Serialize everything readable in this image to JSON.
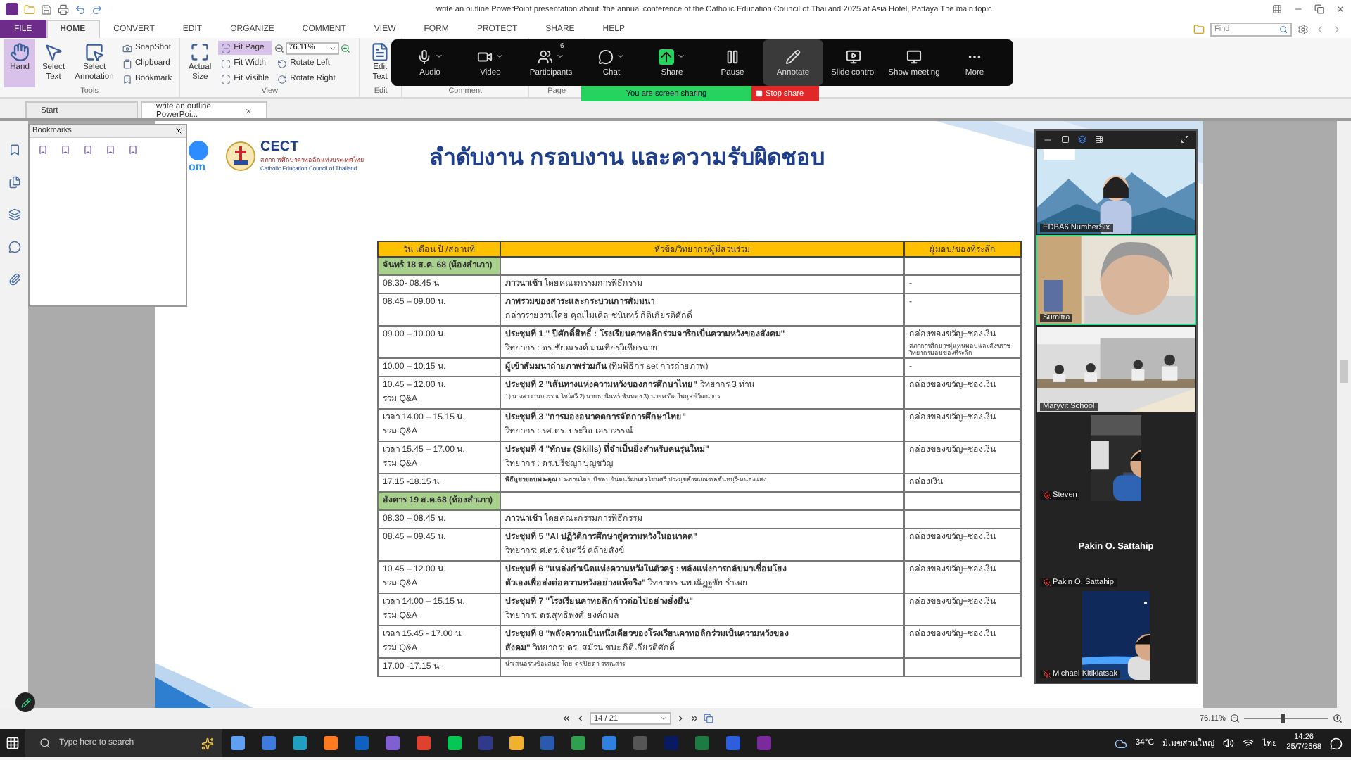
{
  "title_bar": {
    "title": "write an outline PowerPoint presentation about \"the annual conference of the Catholic Education Council of Thailand 2025 at Asia Hotel, Pattaya The main topic"
  },
  "menu_tabs": [
    {
      "label": "FILE",
      "kind": "file",
      "selected": false
    },
    {
      "label": "HOME",
      "kind": "tab",
      "selected": true
    },
    {
      "label": "CONVERT",
      "kind": "tab",
      "selected": false
    },
    {
      "label": "EDIT",
      "kind": "tab",
      "selected": false
    },
    {
      "label": "ORGANIZE",
      "kind": "tab",
      "selected": false
    },
    {
      "label": "COMMENT",
      "kind": "tab",
      "selected": false
    },
    {
      "label": "VIEW",
      "kind": "tab",
      "selected": false
    },
    {
      "label": "FORM",
      "kind": "tab",
      "selected": false
    },
    {
      "label": "PROTECT",
      "kind": "tab",
      "selected": false
    },
    {
      "label": "SHARE",
      "kind": "tab",
      "selected": false
    },
    {
      "label": "HELP",
      "kind": "tab",
      "selected": false
    }
  ],
  "find": {
    "placeholder": "Find"
  },
  "ribbon_groups": [
    {
      "label": "Tools",
      "columns": [
        {
          "kind": "large",
          "label": "Hand",
          "selected": true
        },
        {
          "kind": "large",
          "label": "Select Text",
          "selected": false
        },
        {
          "kind": "large",
          "label": "Select Annotation",
          "selected": false
        },
        {
          "kind": "small",
          "items": [
            {
              "kind": "button",
              "label": "SnapShot",
              "selected": false
            },
            {
              "kind": "button",
              "label": "Clipboard",
              "selected": false
            },
            {
              "kind": "button",
              "label": "Bookmark",
              "selected": false
            }
          ]
        }
      ]
    },
    {
      "label": "View",
      "columns": [
        {
          "kind": "large",
          "label": "Actual Size",
          "selected": false
        },
        {
          "kind": "small",
          "items": [
            {
              "kind": "button",
              "label": "Fit Page",
              "selected": true
            },
            {
              "kind": "button",
              "label": "Fit Width",
              "selected": false
            },
            {
              "kind": "button",
              "label": "Fit Visible",
              "selected": false
            }
          ]
        },
        {
          "kind": "small",
          "items": [
            {
              "kind": "zoom",
              "value": "76.11%"
            },
            {
              "kind": "button",
              "label": "Rotate Left",
              "selected": false
            },
            {
              "kind": "button",
              "label": "Rotate Right",
              "selected": false
            }
          ]
        }
      ]
    },
    {
      "label": "Edit",
      "columns": [
        {
          "kind": "large",
          "label": "Edit Text",
          "selected": false
        }
      ]
    },
    {
      "label": "Comment"
    },
    {
      "label": "Page"
    }
  ],
  "meeting_toolbar": {
    "items": [
      {
        "label": "Audio",
        "selected": false,
        "menu": true
      },
      {
        "label": "Video",
        "selected": false,
        "menu": true
      },
      {
        "label": "Participants",
        "selected": false,
        "menu": true,
        "badge": "6"
      },
      {
        "label": "Chat",
        "selected": false,
        "menu": true
      },
      {
        "label": "Share",
        "selected": false,
        "menu": true
      },
      {
        "label": "Pause",
        "selected": false,
        "menu": false
      },
      {
        "label": "Annotate",
        "selected": true,
        "menu": false
      },
      {
        "label": "Slide control",
        "selected": false,
        "menu": false
      },
      {
        "label": "Show meeting",
        "selected": false,
        "menu": false
      },
      {
        "label": "More",
        "selected": false,
        "menu": false
      }
    ],
    "sharing_status": "You are screen sharing",
    "stop_label": "Stop share"
  },
  "doc_tabs": [
    {
      "label": "Start",
      "selected": false,
      "closable": false
    },
    {
      "label": "write an outline PowerPoi...",
      "selected": true,
      "closable": true
    }
  ],
  "bookmarks": {
    "title": "Bookmarks"
  },
  "slide": {
    "logo_fragment": "om",
    "org": {
      "acronym": "CECT",
      "name_th": "สภาการศึกษาคาทอลิกแห่งประเทศไทย",
      "name_en": "Catholic Education Council of Thailand"
    },
    "heading": "ลำดับงาน กรอบงาน และความรับผิดชอบ",
    "table": {
      "columns": [
        "วัน เดือน ปี /สถานที่",
        "หัวข้อ/วิทยากร/ผู้มีส่วนร่วม",
        "ผู้มอบ/ของที่ระลึก"
      ],
      "rows": [
        {
          "kind": "day",
          "label": "จันทร์ 18 ส.ค. 68 (ห้องสำเภา)"
        },
        {
          "kind": "item",
          "time": [
            "08.30- 08.45 น"
          ],
          "topic": [
            {
              "text": "**ภาวนาเช้า**  โดยคณะกรรมการพิธีกรรม",
              "fine": false
            }
          ],
          "gift": [
            {
              "text": "-",
              "fine": false
            }
          ]
        },
        {
          "kind": "item",
          "time": [
            "08.45 – 09.00 น."
          ],
          "topic": [
            {
              "text": "**ภาพรวมของสาระและกระบวนการสัมมนา**",
              "fine": false
            },
            {
              "text": "กล่าวรายงานโดย   คุณไมเคิล ชนินทร์ กิติเกียรติศักดิ์",
              "fine": false
            }
          ],
          "gift": [
            {
              "text": "-",
              "fine": false
            }
          ]
        },
        {
          "kind": "item",
          "time": [
            "09.00 – 10.00 น."
          ],
          "topic": [
            {
              "text": "**ประชุมที่  1 \" ปีศักดิ์สิทธิ์ : โรงเรียนคาทอลิกร่วมจาริกเป็นความหวังของสังคม\"**",
              "fine": false
            },
            {
              "text": "วิทยากร :  ดร.ชัยณรงค์ มนเทียรวิเชียรฉาย",
              "fine": false
            }
          ],
          "gift": [
            {
              "text": "กล่องของขวัญ+ซองเงิน",
              "fine": false
            },
            {
              "text": "สภาการศึกษาฯผู้แทนมอบและสังฆราชวิทยากรมอบของที่ระลึก",
              "fine": true
            }
          ]
        },
        {
          "kind": "item",
          "time": [
            "10.00 – 10.15 น."
          ],
          "topic": [
            {
              "text": "**ผู้เข้าสัมมนาถ่ายภาพร่วมกัน**  (ทีมพิธีกร set การถ่ายภาพ)",
              "fine": false
            }
          ],
          "gift": [
            {
              "text": "-",
              "fine": false
            }
          ]
        },
        {
          "kind": "item",
          "time": [
            "10.45 – 12.00 น.",
            "รวม Q&A"
          ],
          "topic": [
            {
              "text": "**ประชุมที่  2  \"เส้นทางแห่งความหวังของการศึกษาไทย\"**  วิทยากร 3 ท่าน",
              "fine": false
            },
            {
              "text": "1) นางสาวกนกวรรณ โชว์ศรี  2) นายธานินทร์ พันทอง  3) นายศรวิต ไพบูลย์วัฒนากร",
              "fine": true
            }
          ],
          "gift": [
            {
              "text": "กล่องของขวัญ+ซองเงิน",
              "fine": false
            }
          ]
        },
        {
          "kind": "item",
          "time": [
            "เวลา 14.00 – 15.15 น.",
            "รวม Q&A"
          ],
          "topic": [
            {
              "text": "**ประชุมที่ 3 \"การมองอนาคตการจัดการศึกษาไทย\"**",
              "fine": false
            },
            {
              "text": "วิทยากร :  รศ.ดร. ประวิต เอราวรรณ์",
              "fine": false
            }
          ],
          "gift": [
            {
              "text": "กล่องของขวัญ+ซองเงิน",
              "fine": false
            }
          ]
        },
        {
          "kind": "item",
          "time": [
            "เวลา 15.45 – 17.00 น.",
            "รวม Q&A"
          ],
          "topic": [
            {
              "text": "**ประชุมที่ 4 \"ทักษะ (Skills) ที่จำเป็นยิ่งสำหรับคนรุ่นใหม่\"**",
              "fine": false
            },
            {
              "text": "วิทยากร : ดร.ปรีชญา บุญชวัญ",
              "fine": false
            }
          ],
          "gift": [
            {
              "text": "กล่องของขวัญ+ซองเงิน",
              "fine": false
            }
          ]
        },
        {
          "kind": "item",
          "time": [
            "17.15 -18.15 น."
          ],
          "topic": [
            {
              "text": "**พิธีบูชาขอบพระคุณ** ประธานโดย บิชอปยันตนวัฒนศร โชนศรี ประมุขสังฆมณฑลจันทบุรี-หนองแสง",
              "fine": true
            }
          ],
          "gift": [
            {
              "text": "กล่องเงิน",
              "fine": false
            }
          ]
        },
        {
          "kind": "day",
          "label": "อังคาร 19 ส.ค.68 (ห้องสำเภา)"
        },
        {
          "kind": "item",
          "time": [
            "08.30 – 08.45 น."
          ],
          "topic": [
            {
              "text": "**ภาวนาเช้า**  โดยคณะกรรมการพิธีกรรม",
              "fine": false
            }
          ],
          "gift": []
        },
        {
          "kind": "item",
          "time": [
            "08.45 – 09.45 น."
          ],
          "topic": [
            {
              "text": "**ประชุมที่  5 \"AI ปฏิวัติการศึกษาสู่ความหวังในอนาคต\"**",
              "fine": false
            },
            {
              "text": "วิทยากร:   ศ.ดร.จินตวีร์ คล้ายสังข์",
              "fine": false
            }
          ],
          "gift": [
            {
              "text": "กล่องของขวัญ+ซองเงิน",
              "fine": false
            }
          ]
        },
        {
          "kind": "item",
          "time": [
            "10.45 – 12.00 น.",
            "รวม Q&A"
          ],
          "topic": [
            {
              "text": "**ประชุมที่  6 \"แหล่งกำเนิดแห่งความหวังในตัวครู : พลังแห่งการกลับมาเชื่อมโยง**",
              "fine": false
            },
            {
              "text": "**ตัวเองเพื่อส่งต่อความหวังอย่างแท้จริง\"**  วิทยากร นพ.ณัฏฐชัย รำเพย",
              "fine": false
            }
          ],
          "gift": [
            {
              "text": "กล่องของขวัญ+ซองเงิน",
              "fine": false
            }
          ]
        },
        {
          "kind": "item",
          "time": [
            "เวลา 14.00 – 15.15 น.",
            "รวม Q&A"
          ],
          "topic": [
            {
              "text": "**ประชุมที่  7 \"โรงเรียนคาทอลิกก้าวต่อไปอย่างยั่งยืน\"**",
              "fine": false
            },
            {
              "text": "วิทยากร: ดร.สุทธิพงศ์ ยงค์กมล",
              "fine": false
            }
          ],
          "gift": [
            {
              "text": "กล่องของขวัญ+ซองเงิน",
              "fine": false
            }
          ]
        },
        {
          "kind": "item",
          "time": [
            "เวลา 15.45 - 17.00 น.",
            "รวม Q&A"
          ],
          "topic": [
            {
              "text": "**ประชุมที่ 8 \"พลังความเป็นหนึ่งเดียวของโรงเรียนคาทอลิกร่วมเป็นความหวังของ**",
              "fine": false
            },
            {
              "text": "**สังคม\"** วิทยากร: ดร. สมัวน ชนะ กิติเกียรติศักดิ์",
              "fine": false
            }
          ],
          "gift": [
            {
              "text": "กล่องของขวัญ+ซองเงิน",
              "fine": false
            }
          ]
        },
        {
          "kind": "item",
          "time": [
            "17.00 -17.15 น."
          ],
          "topic": [
            {
              "text": "นำเสนอร่างข้อเสนอ โดย ดร.ปิยดา  วรรณสาร",
              "fine": true
            }
          ],
          "gift": []
        }
      ]
    }
  },
  "video_panel": {
    "participants": [
      {
        "name": "EDBA6 NumberSix",
        "kind": "video",
        "muted": false,
        "speaking": false
      },
      {
        "name": "Sumitra",
        "kind": "video",
        "muted": false,
        "speaking": true
      },
      {
        "name": "Maryvit School",
        "kind": "video",
        "muted": false,
        "speaking": false
      },
      {
        "name": "Steven",
        "kind": "portrait",
        "muted": true,
        "speaking": false
      },
      {
        "name": "Pakin O. Sattahip",
        "display_name": "Pakin O. Sattahip",
        "kind": "name",
        "muted": true,
        "speaking": false
      },
      {
        "name": "Michael Kitikiatsak",
        "kind": "portrait",
        "muted": true,
        "speaking": false
      }
    ]
  },
  "status_bar": {
    "page": "14 / 21",
    "zoom": "76.11%",
    "zoom_slider": {
      "level": 0.45
    }
  },
  "taskbar": {
    "search_placeholder": "Type here to search",
    "temperature": "34°C",
    "weather": "มีเมฆส่วนใหญ่",
    "language": "ไทย",
    "time": "14:26",
    "date": "25/7/2568"
  }
}
